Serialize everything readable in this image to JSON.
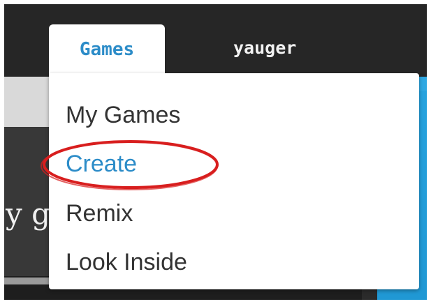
{
  "navbar": {
    "games_tab_label": "Games",
    "username": "yauger"
  },
  "background": {
    "partial_text": "y g"
  },
  "dropdown": {
    "items": [
      {
        "label": "My Games",
        "active": false
      },
      {
        "label": "Create",
        "active": true
      },
      {
        "label": "Remix",
        "active": false
      },
      {
        "label": "Look Inside",
        "active": false
      }
    ]
  },
  "colors": {
    "accent": "#2c8cc8",
    "annotation": "#d81e1e",
    "navbar": "#262626",
    "side_blue": "#27a3df"
  },
  "annotation": {
    "shape": "ellipse",
    "target": "Create"
  }
}
